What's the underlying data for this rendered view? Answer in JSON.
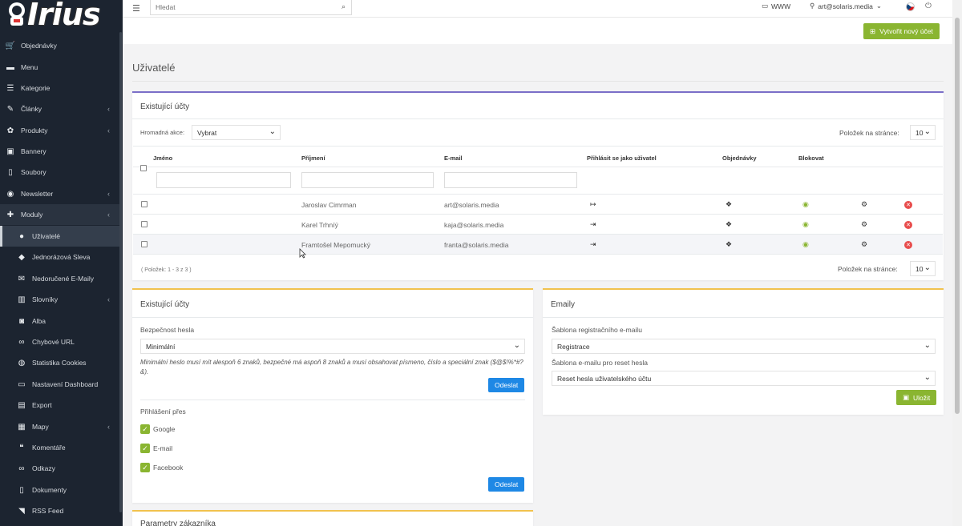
{
  "brand": {
    "logo_text": "Irius"
  },
  "sidebar": {
    "items": [
      {
        "label": "Objednávky",
        "icon": "cart-icon",
        "glyph": "🛒"
      },
      {
        "label": "Menu",
        "icon": "folder-icon",
        "glyph": "▬"
      },
      {
        "label": "Kategorie",
        "icon": "list-icon",
        "glyph": "☰"
      },
      {
        "label": "Články",
        "icon": "pencil-icon",
        "glyph": "✎"
      },
      {
        "label": "Produkty",
        "icon": "palette-icon",
        "glyph": "✿"
      },
      {
        "label": "Bannery",
        "icon": "image-icon",
        "glyph": "▣"
      },
      {
        "label": "Soubory",
        "icon": "file-icon",
        "glyph": "▯"
      },
      {
        "label": "Newsletter",
        "icon": "globe-icon",
        "glyph": "◉"
      },
      {
        "label": "Moduly",
        "icon": "puzzle-icon",
        "glyph": "✚"
      },
      {
        "label": "Uživatelé",
        "icon": "user-icon",
        "glyph": "●"
      },
      {
        "label": "Jednorázová Sleva",
        "icon": "tag-icon",
        "glyph": "◆"
      },
      {
        "label": "Nedoručené E-Maily",
        "icon": "mail-icon",
        "glyph": "✉"
      },
      {
        "label": "Slovníky",
        "icon": "books-icon",
        "glyph": "▥"
      },
      {
        "label": "Alba",
        "icon": "camera-icon",
        "glyph": "◙"
      },
      {
        "label": "Chybové URL",
        "icon": "link-icon",
        "glyph": "∞"
      },
      {
        "label": "Statistika Cookies",
        "icon": "cookie-icon",
        "glyph": "◍"
      },
      {
        "label": "Nastavení Dashboard",
        "icon": "monitor-icon",
        "glyph": "▭"
      },
      {
        "label": "Export",
        "icon": "export-file-icon",
        "glyph": "▤"
      },
      {
        "label": "Mapy",
        "icon": "map-icon",
        "glyph": "▦"
      },
      {
        "label": "Komentáře",
        "icon": "comments-icon",
        "glyph": "❝"
      },
      {
        "label": "Odkazy",
        "icon": "link-icon",
        "glyph": "∞"
      },
      {
        "label": "Dokumenty",
        "icon": "document-icon",
        "glyph": "▯"
      },
      {
        "label": "RSS Feed",
        "icon": "rss-icon",
        "glyph": "◥"
      }
    ]
  },
  "topbar": {
    "search_placeholder": "Hledat",
    "www_label": "WWW",
    "user_label": "art@solaris.media"
  },
  "actions": {
    "create_label": "Vytvořit nový účet"
  },
  "page": {
    "title": "Uživatelé"
  },
  "accounts": {
    "title": "Existující účty",
    "bulk_label": "Hromadná akce:",
    "bulk_value": "Vybrat",
    "per_page_label": "Položek na stránce:",
    "per_page_value": "10",
    "columns": [
      "Jméno",
      "Příjmení",
      "E-mail",
      "Přihlásit se jako uživatel",
      "Objednávky",
      "Blokovat"
    ],
    "rows": [
      {
        "surname": "Jaroslav Cimrman",
        "email": "art@solaris.media"
      },
      {
        "surname": "Karel Trhníý",
        "email": "kaja@solaris.media"
      },
      {
        "surname": "Framtošel Mepomucký",
        "email": "franta@solaris.media"
      }
    ],
    "pagination_info": "( Položek: 1 - 3 z 3 )"
  },
  "security": {
    "title": "Existující účty",
    "password_label": "Bezpečnost hesla",
    "password_value": "Minimální",
    "hint": "Minimální heslo musí mít alespoň 6 znaků, bezpečné má aspoň 8 znaků a musí obsahovat písmeno, číslo a speciální znak ($@$!%*#?&).",
    "submit_label": "Odeslat",
    "login_via_label": "Přihlášení přes",
    "providers": [
      "Google",
      "E-mail",
      "Facebook"
    ],
    "submit2_label": "Odeslat"
  },
  "emails": {
    "title": "Emaily",
    "reg_label": "Šablona registračního e-mailu",
    "reg_value": "Registrace",
    "reset_label": "Šablona e-mailu pro reset hesla",
    "reset_value": "Reset hesla uživatelského účtu",
    "save_label": "Uložit"
  },
  "customer_params": {
    "title": "Parametry zákazníka"
  }
}
